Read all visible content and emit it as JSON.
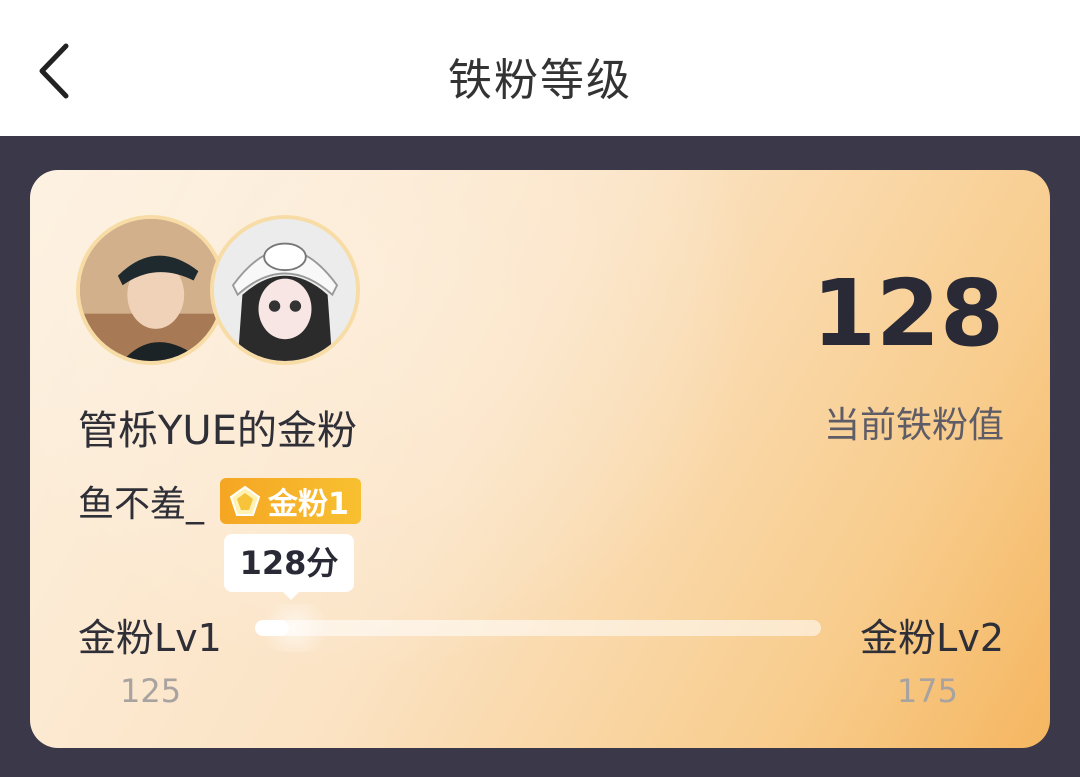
{
  "header": {
    "title": "铁粉等级",
    "back_icon": "chevron-left-icon"
  },
  "card": {
    "group_name": "管栎YUE的金粉",
    "user_name": "鱼不羞_",
    "badge": {
      "label": "金粉1",
      "icon": "gem-icon",
      "color": "#f5a623"
    },
    "score": {
      "value": "128",
      "label": "当前铁粉值"
    },
    "progress": {
      "tooltip": "128分",
      "current_level": "金粉Lv1",
      "next_level": "金粉Lv2",
      "min": "125",
      "max": "175",
      "fraction": 0.06
    }
  }
}
